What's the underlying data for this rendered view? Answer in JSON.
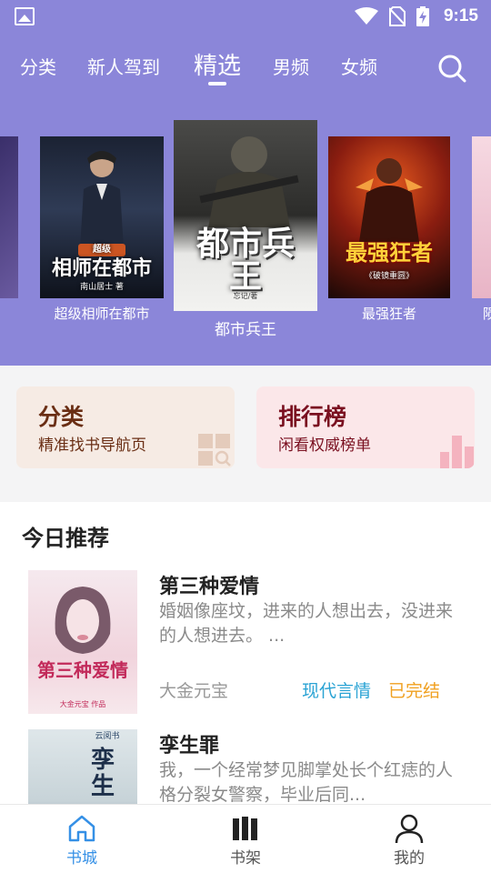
{
  "status_bar": {
    "time": "9:15",
    "icons": [
      "gallery-icon",
      "wifi-icon",
      "no-sim-icon",
      "battery-charging-icon"
    ]
  },
  "tabs": [
    {
      "label": "分类",
      "active": false
    },
    {
      "label": "新人驾到",
      "active": false
    },
    {
      "label": "精选",
      "active": true
    },
    {
      "label": "男频",
      "active": false
    },
    {
      "label": "女频",
      "active": false
    }
  ],
  "search": {
    "icon": "search-icon"
  },
  "carousel": {
    "books": [
      {
        "title": "",
        "cover_text": ""
      },
      {
        "title": "超级相师在都市",
        "cover_text": "相师在都市",
        "cover_badge": "超级",
        "cover_author": "南山居士 著"
      },
      {
        "title": "都市兵王",
        "cover_text": "都市兵王",
        "cover_author": "忘记/著"
      },
      {
        "title": "最强狂者",
        "cover_text": "最强狂者",
        "cover_author": "《破镜重圆》"
      },
      {
        "title": "陨"
      }
    ]
  },
  "entries": {
    "category": {
      "title": "分类",
      "subtitle": "精准找书导航页",
      "icon": "grid-search-icon"
    },
    "ranking": {
      "title": "排行榜",
      "subtitle": "闲看权威榜单",
      "icon": "bar-chart-icon"
    }
  },
  "recommend": {
    "title": "今日推荐",
    "books": [
      {
        "title": "第三种爱情",
        "desc": "婚姻像座坟，进来的人想出去，没进来的人想进去。 ...",
        "author": "大金元宝",
        "genre": "现代言情",
        "status": "已完结",
        "cover_text": "第三种爱情",
        "cover_author": "大金元宝 作品"
      },
      {
        "title": "孪生罪",
        "desc": "我，一个经常梦见脚掌处长个红痣的人格分裂女警察，毕业后同...",
        "author": "",
        "genre": "",
        "status": "",
        "cover_text": "孪生",
        "cover_badge": "云阅书"
      }
    ]
  },
  "bottom_nav": [
    {
      "label": "书城",
      "icon": "home-icon",
      "active": true
    },
    {
      "label": "书架",
      "icon": "bookshelf-icon",
      "active": false
    },
    {
      "label": "我的",
      "icon": "user-icon",
      "active": false
    }
  ],
  "colors": {
    "hero": "#8b86d9",
    "accent": "#3590e6",
    "genre": "#2aa3d4",
    "status": "#f0a020"
  }
}
